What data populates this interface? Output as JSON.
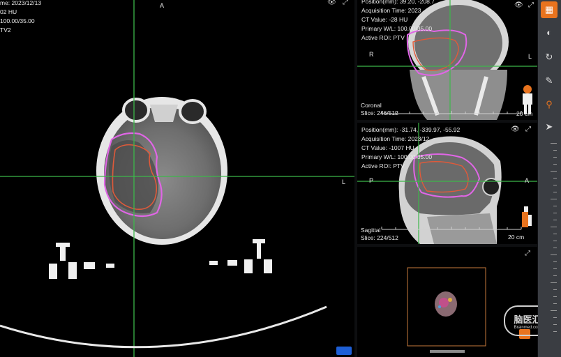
{
  "axial": {
    "lines": [
      "me: 2023/12/13",
      "02 HU",
      "100.00/35.00",
      "TV2"
    ],
    "orient_top": "A",
    "orient_right": "L",
    "eye_icon": "eye-icon",
    "expand_icon": "expand-icon"
  },
  "coronal": {
    "lines": [
      "Position(mm): 39.20, -208.7",
      "Acquisition Time: 2023",
      "CT Value: -28 HU",
      "Primary W/L: 100.00/35.00",
      "Active ROI: PTV"
    ],
    "orient_left": "R",
    "orient_right": "L",
    "view_label": "Coronal",
    "slice_label": "Slice: 246/512",
    "scale_label": "20 cm"
  },
  "sagittal": {
    "lines": [
      "Position(mm): -31.74, -339.97, -55.92",
      "Acquisition Time: 2023/12",
      "CT Value: -1007 HU",
      "Primary W/L: 100.00/35.00",
      "Active ROI: PTV"
    ],
    "orient_left": "P",
    "orient_right": "A",
    "view_label": "Sagittal",
    "slice_label": "Slice: 224/512",
    "scale_label": "20 cm"
  },
  "watermark": {
    "title": "脑医汇",
    "sub": "Brainmed.com"
  },
  "toolbar": {
    "items": [
      "layout-icon",
      "contrast-icon",
      "rotate-icon",
      "ruler-icon",
      "zoom-icon",
      "pointer-icon"
    ]
  },
  "colors": {
    "crosshair": "#3cb84a",
    "roi_pink": "#e066e6",
    "roi_red": "#e05a3a",
    "toolbar_active": "#e8731e"
  }
}
